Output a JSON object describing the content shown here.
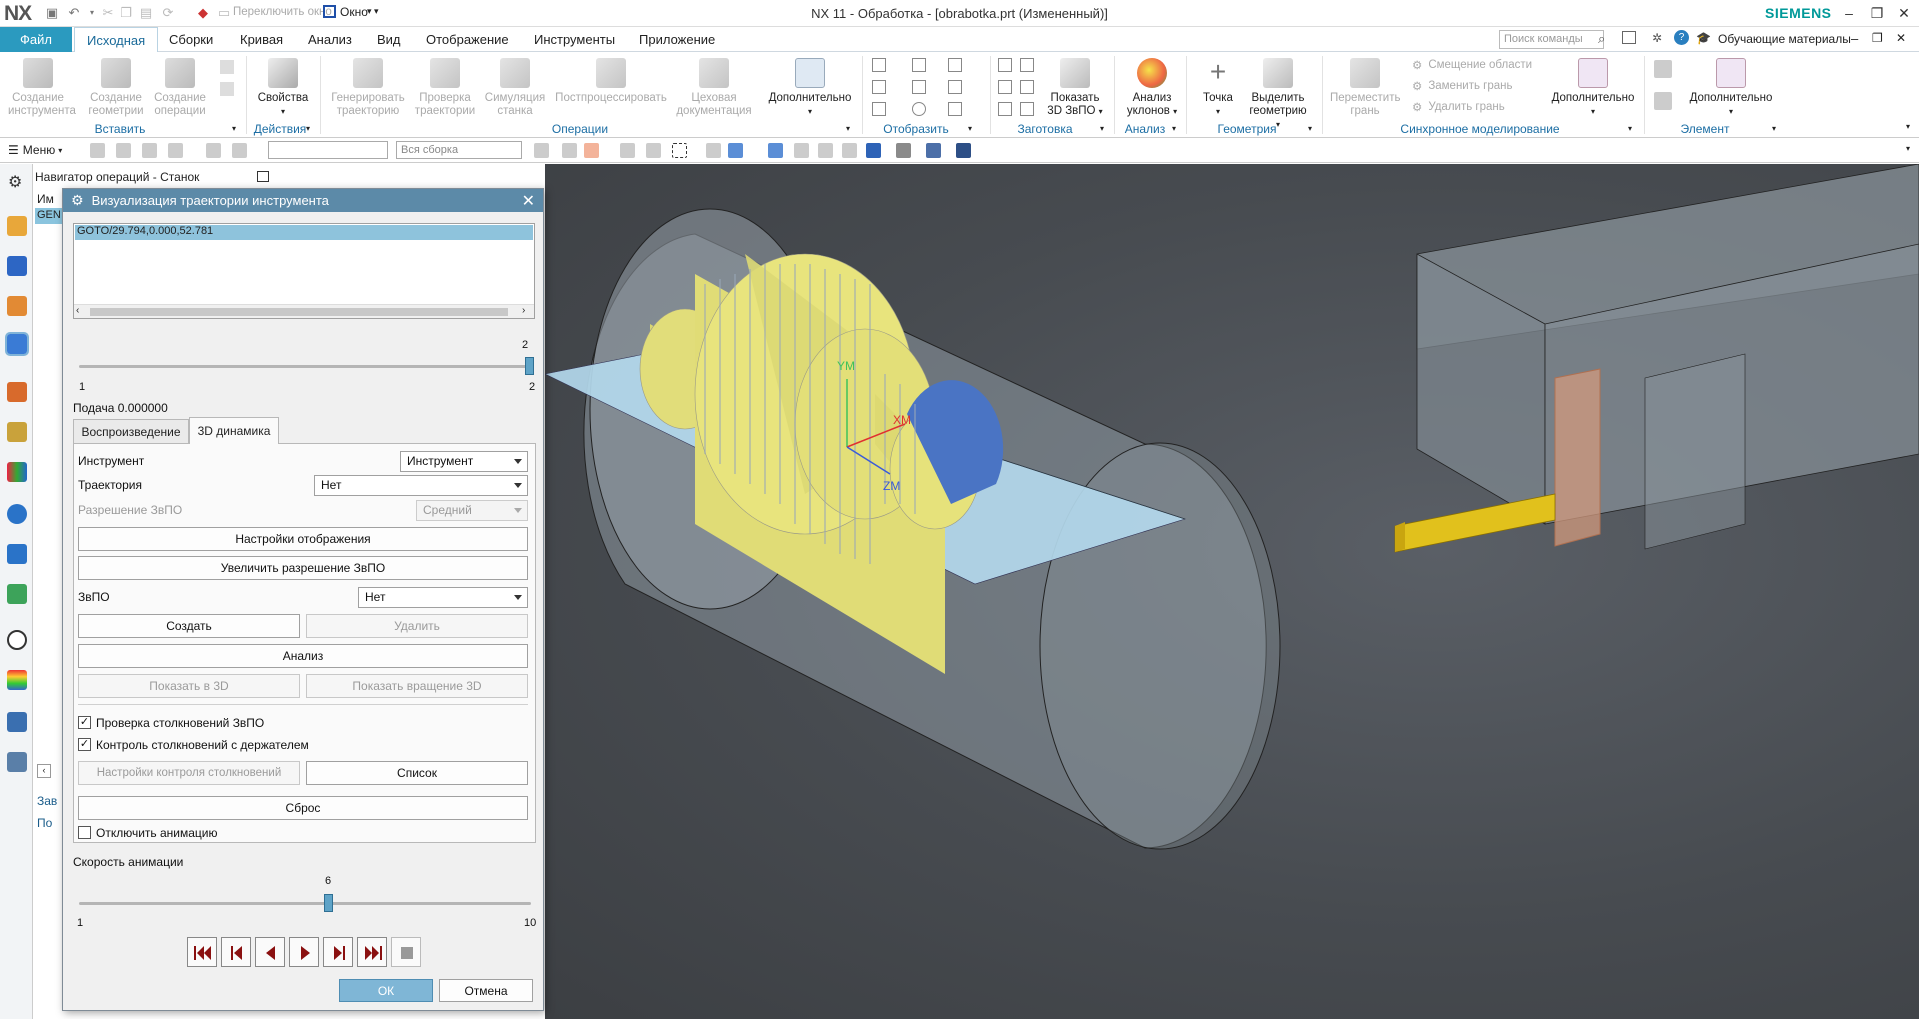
{
  "title_bar": {
    "logo": "NX",
    "switch_window": "Переключить окно",
    "window_menu": "Окно",
    "title": "NX 11 - Обработка - [obrabotka.prt (Измененный)]",
    "brand": "SIEMENS"
  },
  "menu": {
    "file": "Файл",
    "tabs": [
      "Исходная",
      "Сборки",
      "Кривая",
      "Анализ",
      "Вид",
      "Отображение",
      "Инструменты",
      "Приложение"
    ],
    "search_placeholder": "Поиск команды",
    "learning": "Обучающие материалы"
  },
  "ribbon": {
    "create_tool": "Создание инструмента",
    "create_geometry": "Создание геометрии",
    "create_operation": "Создание операции",
    "insert_group": "Вставить",
    "properties": "Свойства",
    "actions_group": "Действия",
    "generate_path": "Генерировать траекторию",
    "verify_path": "Проверка траектории",
    "machine_sim": "Симуляция станка",
    "postprocess": "Постпроцессировать",
    "shop_doc": "Цеховая документация",
    "more": "Дополнительно",
    "operations_group": "Операции",
    "display_group": "Отобразить",
    "show_ipw": "Показать 3D ЗвПО",
    "blank_group": "Заготовка",
    "draft_analysis": "Анализ уклонов",
    "analysis_group": "Анализ",
    "point": "Точка",
    "extract_geometry": "Выделить геометрию",
    "geometry_group": "Геометрия",
    "move_face": "Переместить грань",
    "offset_region": "Смещение области",
    "replace_face": "Заменить грань",
    "delete_face": "Удалить грань",
    "sync_group": "Синхронное моделирование",
    "element_group": "Элемент"
  },
  "toolbar2": {
    "menu": "Меню",
    "filter_value": "",
    "assembly_value": "Вся сборка"
  },
  "navigator": {
    "title": "Навигатор операций - Станок",
    "col_name": "Им",
    "row_gen": "GEN",
    "bottom1": "Зав",
    "bottom2": "По"
  },
  "dialog": {
    "title": "Визуализация траектории инструмента",
    "cl_line": "GOTO/29.794,0.000,52.781",
    "slider_top_value": "2",
    "slider_min": "1",
    "slider_max": "2",
    "feed": "Подача 0.000000",
    "tab_replay": "Воспроизведение",
    "tab_3d": "3D динамика",
    "tool_label": "Инструмент",
    "tool_value": "Инструмент",
    "path_label": "Траектория",
    "path_value": "Нет",
    "ipw_res_label": "Разрешение ЗвПО",
    "ipw_res_value": "Средний",
    "display_settings": "Настройки отображения",
    "increase_res": "Увеличить разрешение ЗвПО",
    "ipw_label": "ЗвПО",
    "ipw_value": "Нет",
    "create": "Создать",
    "delete": "Удалить",
    "analysis": "Анализ",
    "show_3d": "Показать в 3D",
    "show_rotation": "Показать вращение 3D",
    "check_ipw_collision": "Проверка столкновений ЗвПО",
    "check_holder_collision": "Контроль столкновений с держателем",
    "collision_settings": "Настройки контроля столкновений",
    "list": "Список",
    "reset": "Сброс",
    "disable_anim": "Отключить анимацию",
    "anim_speed": "Скорость анимации",
    "speed_value": "6",
    "speed_min": "1",
    "speed_max": "10",
    "ok": "ОК",
    "cancel": "Отмена"
  },
  "viewport": {
    "axis_y": "YM",
    "axis_x": "XM",
    "axis_z": "ZM"
  },
  "colors": {
    "accent": "#2b9abf",
    "dialog_header": "#5c8aa8",
    "part_yellow": "#e3e07a",
    "blank_blue": "#a9d2e8",
    "viewport_bg": "#474b50"
  }
}
